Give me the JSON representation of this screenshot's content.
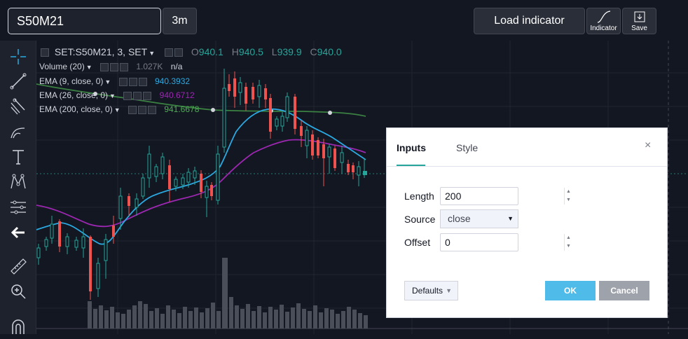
{
  "toolbar": {
    "symbol": "S50M21",
    "interval": "3m",
    "load_indicator": "Load indicator",
    "indicator_label": "Indicator",
    "save_label": "Save"
  },
  "sidebar": {
    "tools": [
      "crosshair-icon",
      "trend-line-icon",
      "fib-icon",
      "brush-icon",
      "text-icon",
      "pattern-icon",
      "measure-icon",
      "back-arrow-icon",
      "ruler-icon",
      "zoom-in-icon",
      "magnet-icon"
    ]
  },
  "chart": {
    "title": "SET:S50M21, 3, SET",
    "open_label": "O",
    "open": "940.1",
    "high_label": "H",
    "high": "940.5",
    "low_label": "L",
    "low": "939.9",
    "close_label": "C",
    "close": "940.0",
    "studies": [
      {
        "name": "Volume (20)",
        "value": "1.027K",
        "extra": "n/a",
        "color": "#787b86"
      },
      {
        "name": "EMA (9, close, 0)",
        "value": "940.3932",
        "color": "#2ca9e1"
      },
      {
        "name": "EMA (26, close, 0)",
        "value": "940.6712",
        "color": "#9c27b0"
      },
      {
        "name": "EMA (200, close, 0)",
        "value": "941.6678",
        "color": "#4caf50"
      }
    ],
    "colors": {
      "up": "#26a69a",
      "down": "#ef5350"
    }
  },
  "dialog": {
    "tab_inputs": "Inputs",
    "tab_style": "Style",
    "close_symbol": "×",
    "length_label": "Length",
    "length_value": "200",
    "source_label": "Source",
    "source_value": "close",
    "offset_label": "Offset",
    "offset_value": "0",
    "defaults_label": "Defaults",
    "ok_label": "OK",
    "cancel_label": "Cancel"
  }
}
